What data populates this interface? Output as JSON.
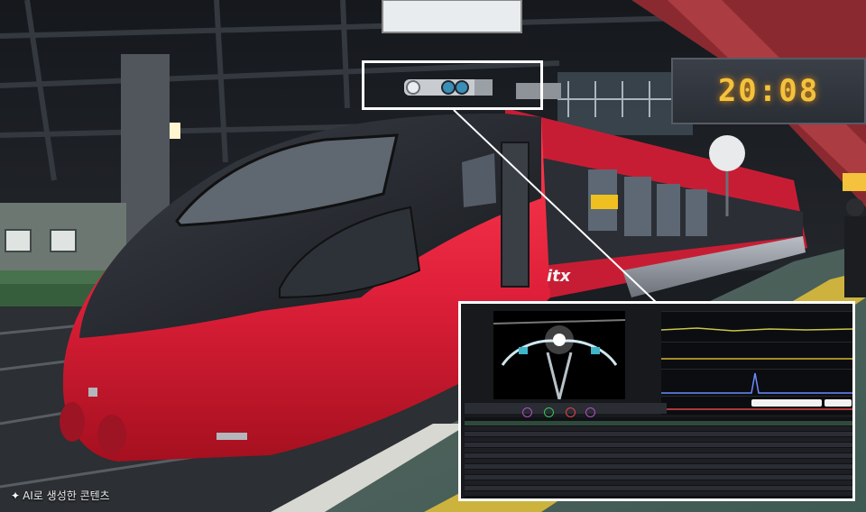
{
  "scene": {
    "clock_time": "20:08",
    "train_brand": "itx",
    "caption": "AI로 생성한 콘텐츠",
    "caption_icon": "sparkle-icon"
  },
  "colors": {
    "train_red": "#d3223a",
    "train_black": "#22252b",
    "clock_amber": "#f4c23c",
    "highlight": "#ffffff"
  }
}
